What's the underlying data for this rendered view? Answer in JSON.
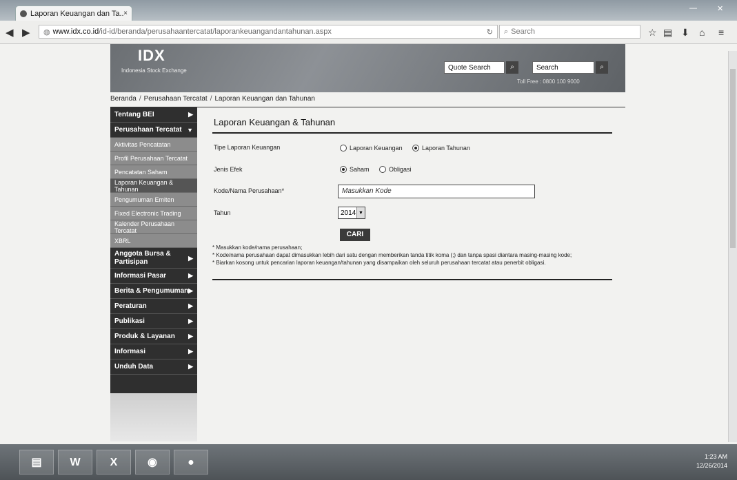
{
  "browser": {
    "tab_title": "Laporan Keuangan dan Ta...",
    "tab_close": "×",
    "url_host": "www.idx.co.id",
    "url_path": "/id-id/beranda/perusahaantercatat/laporankeuangandantahunan.aspx",
    "search_placeholder": "Search"
  },
  "header": {
    "logo": "IDX",
    "logo_sub": "Indonesia Stock Exchange",
    "quote_search_placeholder": "Quote Search",
    "search_placeholder": "Search",
    "toll_free": "Toll Free : 0800 100 9000"
  },
  "breadcrumb": [
    "Beranda",
    "Perusahaan Tercatat",
    "Laporan Keuangan dan Tahunan"
  ],
  "sidebar": {
    "items": [
      {
        "label": "Tentang BEI"
      },
      {
        "label": "Perusahaan Tercatat"
      }
    ],
    "subitems": [
      "Aktivitas Pencatatan",
      "Profil Perusahaan Tercatat",
      "Pencatatan Saham",
      "Laporan Keuangan & Tahunan",
      "Pengumuman Emiten",
      "Fixed Electronic Trading",
      "Kalender Perusahaan Tercatat",
      "XBRL"
    ],
    "lower_items": [
      "Anggota Bursa & Partisipan",
      "Informasi Pasar",
      "Berita & Pengumuman",
      "Peraturan",
      "Publikasi",
      "Produk & Layanan",
      "Informasi",
      "Unduh Data"
    ]
  },
  "form": {
    "title": "Laporan Keuangan & Tahunan",
    "tipe_label": "Tipe Laporan Keuangan",
    "tipe_options": [
      "Laporan Keuangan",
      "Laporan Tahunan"
    ],
    "jenis_label": "Jenis Efek",
    "jenis_options": [
      "Saham",
      "Obligasi"
    ],
    "kode_label": "Kode/Nama Perusahaan*",
    "kode_placeholder": "Masukkan Kode",
    "tahun_label": "Tahun",
    "tahun_value": "2014",
    "cari_label": "CARI",
    "notes": [
      "* Masukkan kode/nama perusahaan;",
      "* Kode/nama perusahaan dapat dimasukkan lebih dari satu dengan memberikan tanda titik koma (;) dan tanpa spasi diantara masing-masing kode;",
      "* Biarkan kosong untuk pencarian laporan keuangan/tahunan yang disampaikan oleh seluruh perusahaan tercatat atau penerbit obligasi."
    ]
  },
  "taskbar": {
    "time": "1:23 AM",
    "date": "12/26/2014"
  }
}
